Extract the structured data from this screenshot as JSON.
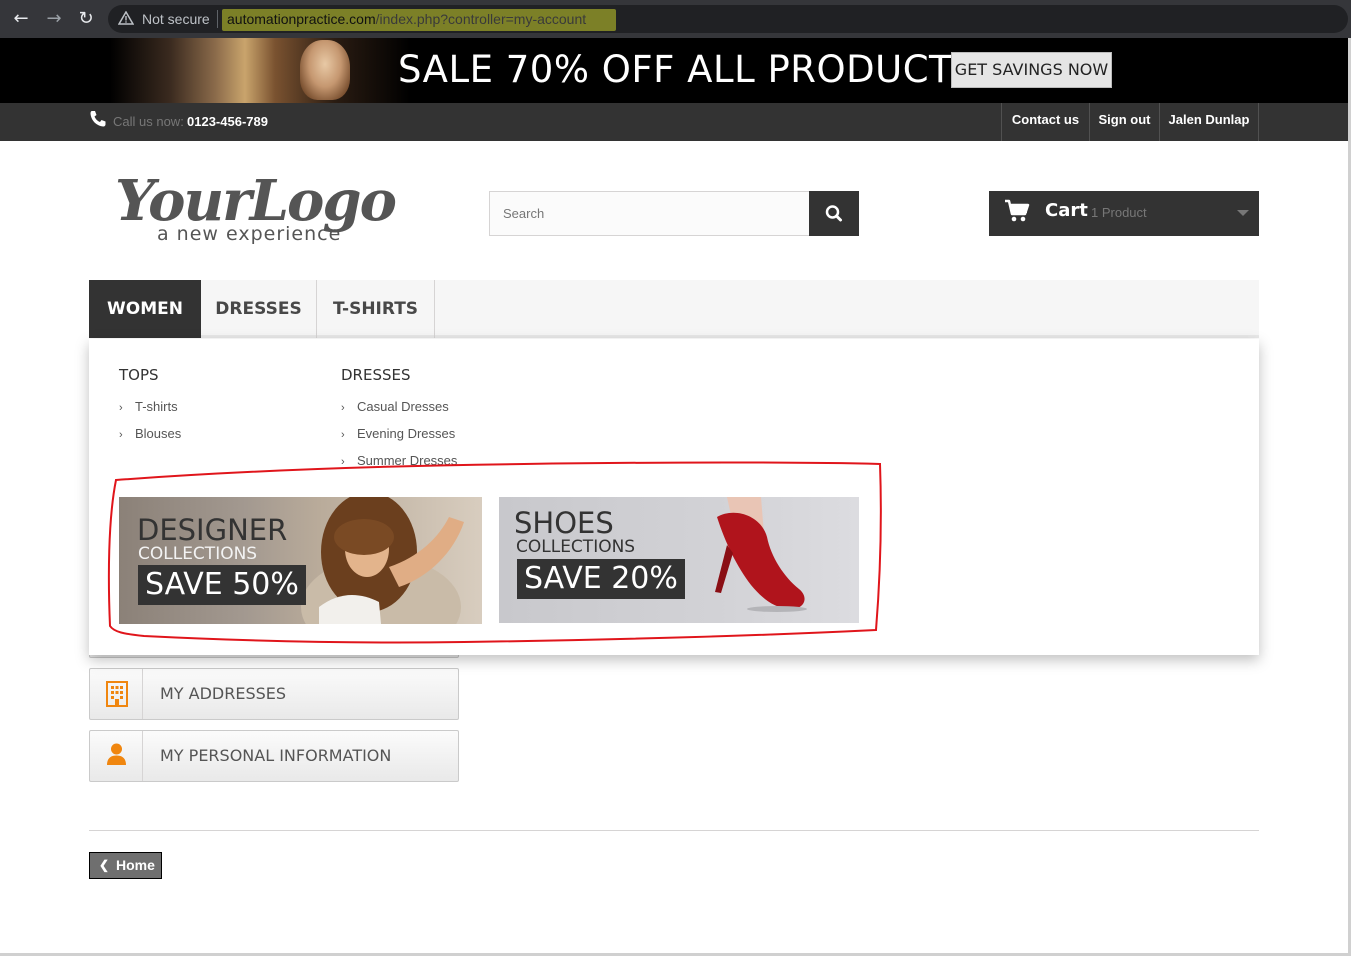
{
  "browser": {
    "back_icon": "arrow-left-icon",
    "forward_icon": "arrow-right-icon",
    "reload_icon": "reload-icon",
    "security_label": "Not secure",
    "url_host": "automationpractice.com",
    "url_path": "/index.php?controller=my-account",
    "highlight_color": "#c9cf2a"
  },
  "promo": {
    "title": "SALE 70% OFF ALL PRODUCTS",
    "button_label": "GET SAVINGS NOW"
  },
  "topbar": {
    "call_label": "Call us now:",
    "phone": "0123-456-789",
    "links": [
      "Contact us",
      "Sign out",
      "Jalen Dunlap"
    ]
  },
  "header": {
    "logo_text": "YourLogo",
    "logo_tagline": "a new experience",
    "search_placeholder": "Search",
    "cart_label": "Cart",
    "cart_count": "1 Product"
  },
  "menu": {
    "tabs": [
      "WOMEN",
      "DRESSES",
      "T-SHIRTS"
    ],
    "active_tab": "WOMEN"
  },
  "dropdown": {
    "categories": [
      {
        "heading": "TOPS",
        "items": [
          "T-shirts",
          "Blouses"
        ]
      },
      {
        "heading": "DRESSES",
        "items": [
          "Casual Dresses",
          "Evening Dresses",
          "Summer Dresses"
        ]
      }
    ],
    "banners": [
      {
        "title": "DESIGNER",
        "subtitle": "COLLECTIONS",
        "save": "SAVE 50%"
      },
      {
        "title": "SHOES",
        "subtitle": "COLLECTIONS",
        "save": "SAVE 20%"
      }
    ],
    "annotation_color": "#e0151b"
  },
  "account": {
    "buttons": [
      {
        "label": "MY ADDRESSES",
        "icon": "building-icon"
      },
      {
        "label": "MY PERSONAL INFORMATION",
        "icon": "user-icon"
      }
    ],
    "icon_color": "#f0860f"
  },
  "footer": {
    "home_label": "Home"
  }
}
